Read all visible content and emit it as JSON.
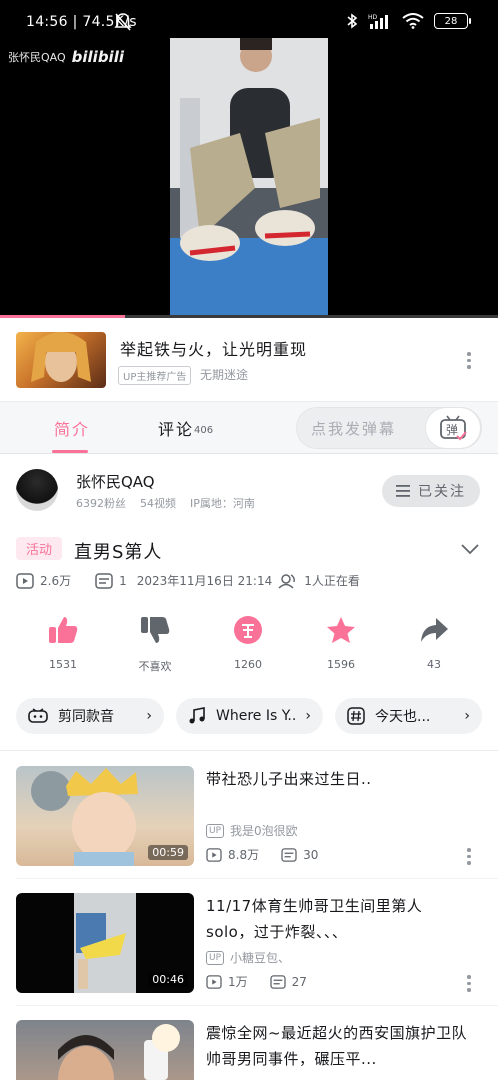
{
  "status_bar": {
    "time": "14:56",
    "speed": "74.5K/s",
    "battery": "28"
  },
  "player": {
    "watermark_user": "张怀民QAQ",
    "watermark_brand": "bilibili",
    "progress_fraction": 0.25
  },
  "ad": {
    "title": "举起铁与火，让光明重现",
    "badge": "UP主推荐广告",
    "subtitle": "无期迷途"
  },
  "tabs": {
    "intro": "简介",
    "comments": "评论",
    "comments_count": "406",
    "danmaku_placeholder": "点我发弹幕",
    "danmaku_button": "弹"
  },
  "uploader": {
    "name": "张怀民QAQ",
    "fans": "6392粉丝",
    "videos": "54视频",
    "ip": "IP属地：河南",
    "follow_label": "已关注"
  },
  "video": {
    "activity_badge": "活动",
    "title": "直男S第人",
    "plays": "2.6万",
    "danmaku": "1",
    "date": "2023年11月16日 21:14",
    "watching": "1人正在看"
  },
  "actions": [
    {
      "name": "like",
      "label": "1531"
    },
    {
      "name": "dislike",
      "label": "不喜欢"
    },
    {
      "name": "coin",
      "label": "1260"
    },
    {
      "name": "favorite",
      "label": "1596"
    },
    {
      "name": "share",
      "label": "43"
    }
  ],
  "tags": [
    {
      "icon": "game-icon",
      "label": "剪同款音"
    },
    {
      "icon": "music-icon",
      "label": "Where Is Y..."
    },
    {
      "icon": "hashtag-icon",
      "label": "今天也..."
    }
  ],
  "recommendations": [
    {
      "title": "带社恐儿子出来过生日..",
      "uploader": "我是0泡很欧",
      "plays": "8.8万",
      "danmaku": "30",
      "duration": "00:59"
    },
    {
      "title": "11/17体育生帅哥卫生间里第人solo，过于炸裂、、、",
      "uploader": "小糖豆包、",
      "plays": "1万",
      "danmaku": "27",
      "duration": "00:46"
    },
    {
      "title": "震惊全网~最近超火的西安国旗护卫队帅哥男同事件，碾压平...",
      "uploader": "",
      "plays": "",
      "danmaku": "",
      "duration": ""
    }
  ],
  "colors": {
    "accent": "#fb7299",
    "text": "#18191c",
    "muted": "#9499a0"
  }
}
